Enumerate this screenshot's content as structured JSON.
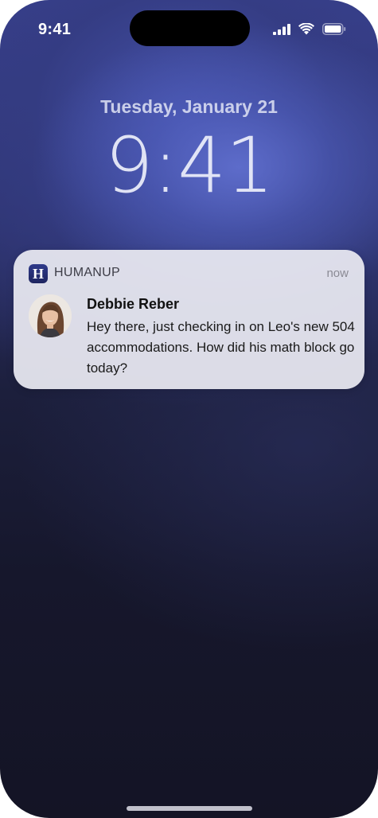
{
  "status_bar": {
    "time": "9:41",
    "icons": [
      "cellular-signal-icon",
      "wifi-icon",
      "battery-icon"
    ]
  },
  "lock_screen": {
    "date": "Tuesday, January 21",
    "time": "9:41"
  },
  "notification": {
    "app_icon_letter": "H",
    "app_name": "HUMANUP",
    "time": "now",
    "sender": "Debbie Reber",
    "message": "Hey there, just checking in on Leo's new 504 accommodations. How did his math block go today?"
  },
  "colors": {
    "accent": "#2f3a8a",
    "background_top": "#3a4192",
    "background_bottom": "#141425"
  }
}
